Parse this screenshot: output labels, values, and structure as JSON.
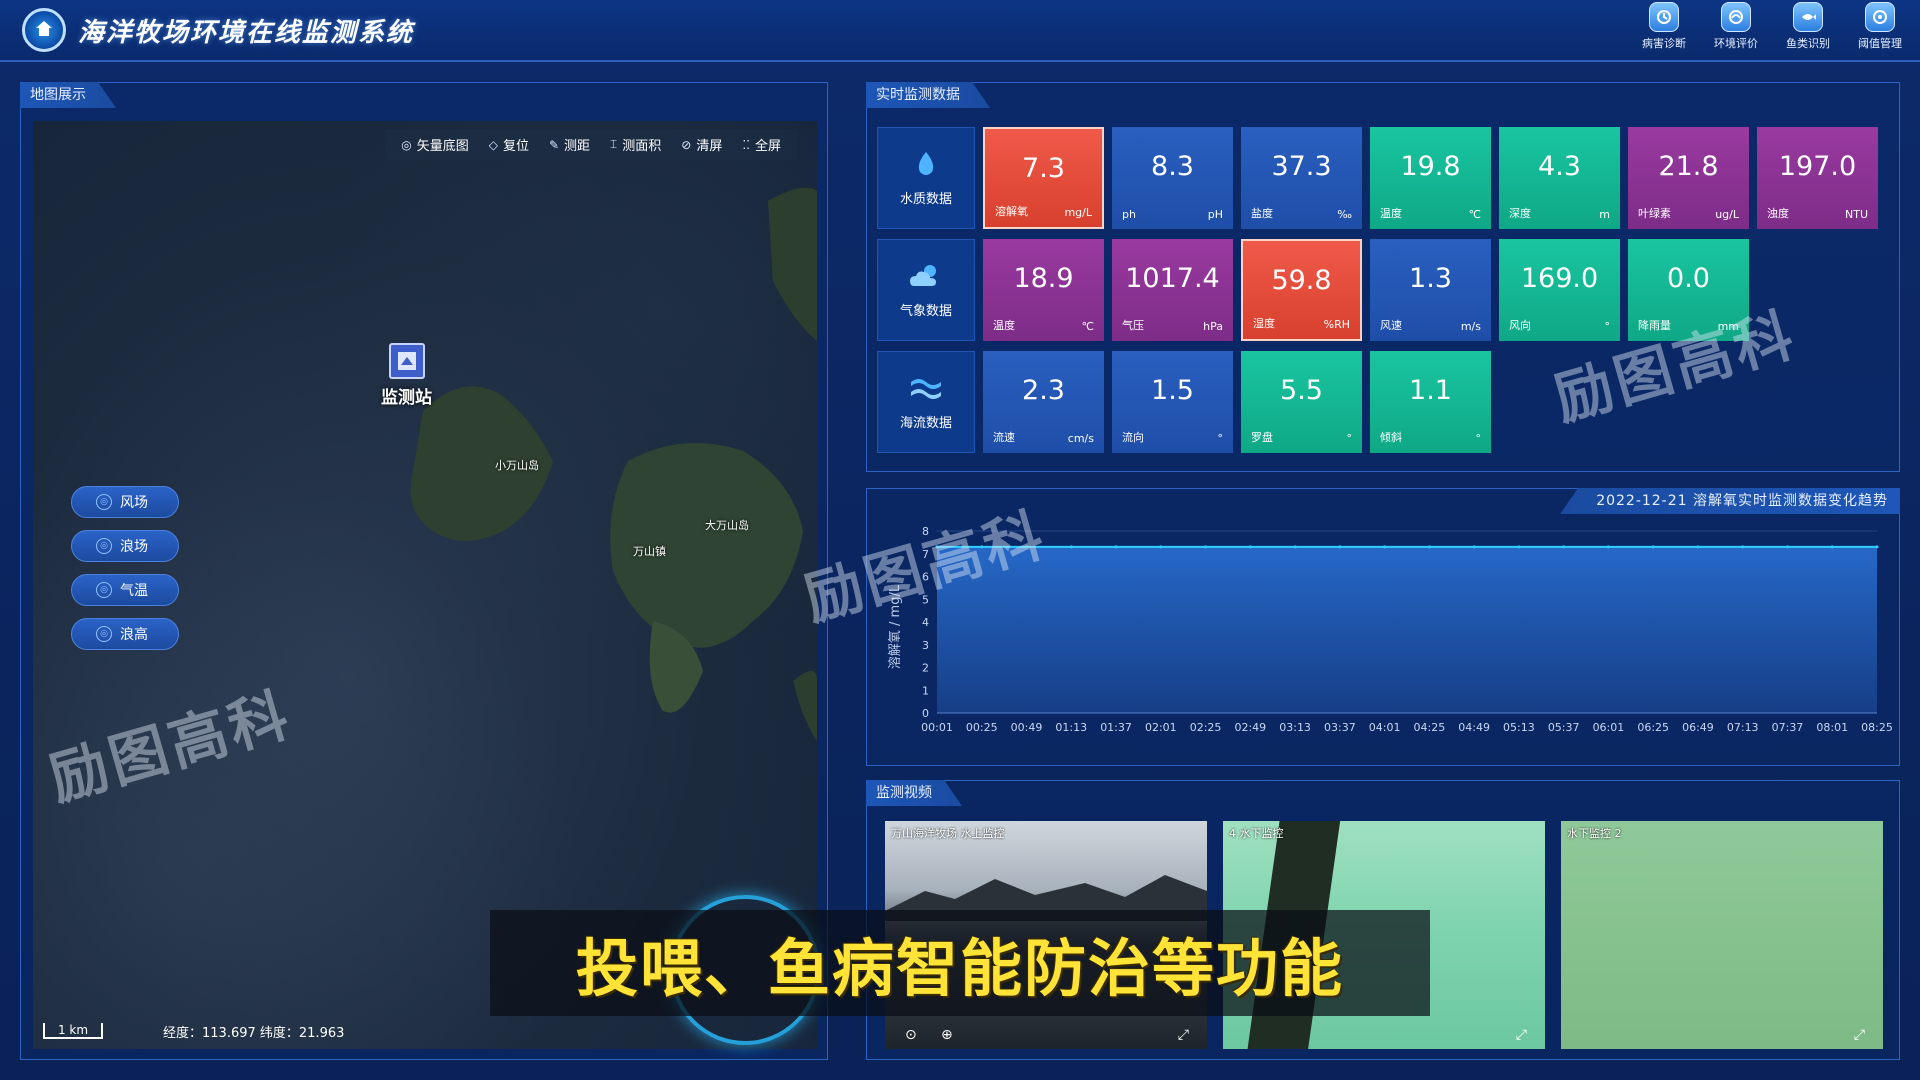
{
  "header": {
    "title": "海洋牧场环境在线监测系统",
    "nav": [
      {
        "label": "病害诊断",
        "icon": "diagnosis-icon"
      },
      {
        "label": "环境评价",
        "icon": "environment-icon"
      },
      {
        "label": "鱼类识别",
        "icon": "fish-icon"
      },
      {
        "label": "阈值管理",
        "icon": "threshold-icon"
      }
    ]
  },
  "map_panel": {
    "title": "地图展示",
    "toolbar": [
      {
        "label": "矢量底图",
        "icon": "layers-icon"
      },
      {
        "label": "复位",
        "icon": "reset-icon"
      },
      {
        "label": "测距",
        "icon": "ruler-icon"
      },
      {
        "label": "测面积",
        "icon": "area-icon"
      },
      {
        "label": "清屏",
        "icon": "clear-icon"
      },
      {
        "label": "全屏",
        "icon": "fullscreen-icon"
      }
    ],
    "station_label": "监测站",
    "island_labels": [
      "小万山岛",
      "大万山岛",
      "万山镇"
    ],
    "layers": [
      "风场",
      "浪场",
      "气温",
      "浪高"
    ],
    "scale": "1 km",
    "coords": "经度：113.697 纬度：21.963"
  },
  "realtime": {
    "title": "实时监测数据",
    "rows": [
      {
        "category": "水质数据",
        "metrics": [
          {
            "value": "7.3",
            "name": "溶解氧",
            "unit": "mg/L",
            "status": "alert"
          },
          {
            "value": "8.3",
            "name": "ph",
            "unit": "pH",
            "status": "normal"
          },
          {
            "value": "37.3",
            "name": "盐度",
            "unit": "‰",
            "status": "normal"
          },
          {
            "value": "19.8",
            "name": "温度",
            "unit": "℃",
            "status": "good"
          },
          {
            "value": "4.3",
            "name": "深度",
            "unit": "m",
            "status": "good"
          },
          {
            "value": "21.8",
            "name": "叶绿素",
            "unit": "ug/L",
            "status": "warn"
          },
          {
            "value": "197.0",
            "name": "浊度",
            "unit": "NTU",
            "status": "warn"
          }
        ]
      },
      {
        "category": "气象数据",
        "metrics": [
          {
            "value": "18.9",
            "name": "温度",
            "unit": "℃",
            "status": "warn"
          },
          {
            "value": "1017.4",
            "name": "气压",
            "unit": "hPa",
            "status": "warn"
          },
          {
            "value": "59.8",
            "name": "湿度",
            "unit": "%RH",
            "status": "alert"
          },
          {
            "value": "1.3",
            "name": "风速",
            "unit": "m/s",
            "status": "normal"
          },
          {
            "value": "169.0",
            "name": "风向",
            "unit": "°",
            "status": "good"
          },
          {
            "value": "0.0",
            "name": "降雨量",
            "unit": "mm",
            "status": "good"
          }
        ]
      },
      {
        "category": "海流数据",
        "metrics": [
          {
            "value": "2.3",
            "name": "流速",
            "unit": "cm/s",
            "status": "normal"
          },
          {
            "value": "1.5",
            "name": "流向",
            "unit": "°",
            "status": "normal"
          },
          {
            "value": "5.5",
            "name": "罗盘",
            "unit": "°",
            "status": "good"
          },
          {
            "value": "1.1",
            "name": "倾斜",
            "unit": "°",
            "status": "good"
          }
        ]
      }
    ]
  },
  "chart_data": {
    "type": "area",
    "title": "2022-12-21 溶解氧实时监测数据变化趋势",
    "xlabel": "",
    "ylabel": "溶解氧 / mg/L",
    "ylim": [
      0,
      8
    ],
    "yticks": [
      0,
      1,
      2,
      3,
      4,
      5,
      6,
      7,
      8
    ],
    "x": [
      "00:01",
      "00:25",
      "00:49",
      "01:13",
      "01:37",
      "02:01",
      "02:25",
      "02:49",
      "03:13",
      "03:37",
      "04:01",
      "04:25",
      "04:49",
      "05:13",
      "05:37",
      "06:01",
      "06:25",
      "06:49",
      "07:13",
      "07:37",
      "08:01",
      "08:25"
    ],
    "series": [
      {
        "values": [
          7.3,
          7.3,
          7.3,
          7.3,
          7.3,
          7.3,
          7.3,
          7.3,
          7.3,
          7.3,
          7.3,
          7.3,
          7.3,
          7.3,
          7.3,
          7.3,
          7.3,
          7.3,
          7.3,
          7.3,
          7.3,
          7.3
        ]
      }
    ],
    "grid": true,
    "colors": {
      "line": "#2fd0ff",
      "fill_top": "#2668c8",
      "fill_bottom": "#163e86"
    }
  },
  "video_panel": {
    "title": "监测视频",
    "cams": [
      {
        "caption": "万山海洋牧场 水上监控"
      },
      {
        "caption": "4 水下监控"
      },
      {
        "caption": "水下监控 2"
      }
    ]
  },
  "overlay": {
    "subtitle": "投喂、鱼病智能防治等功能",
    "watermark": "励图高科"
  },
  "colors": {
    "alert": "#e8503e",
    "normal": "#2556b8",
    "good": "#14b892",
    "warn": "#8a3394",
    "accent": "#2fd0ff"
  }
}
